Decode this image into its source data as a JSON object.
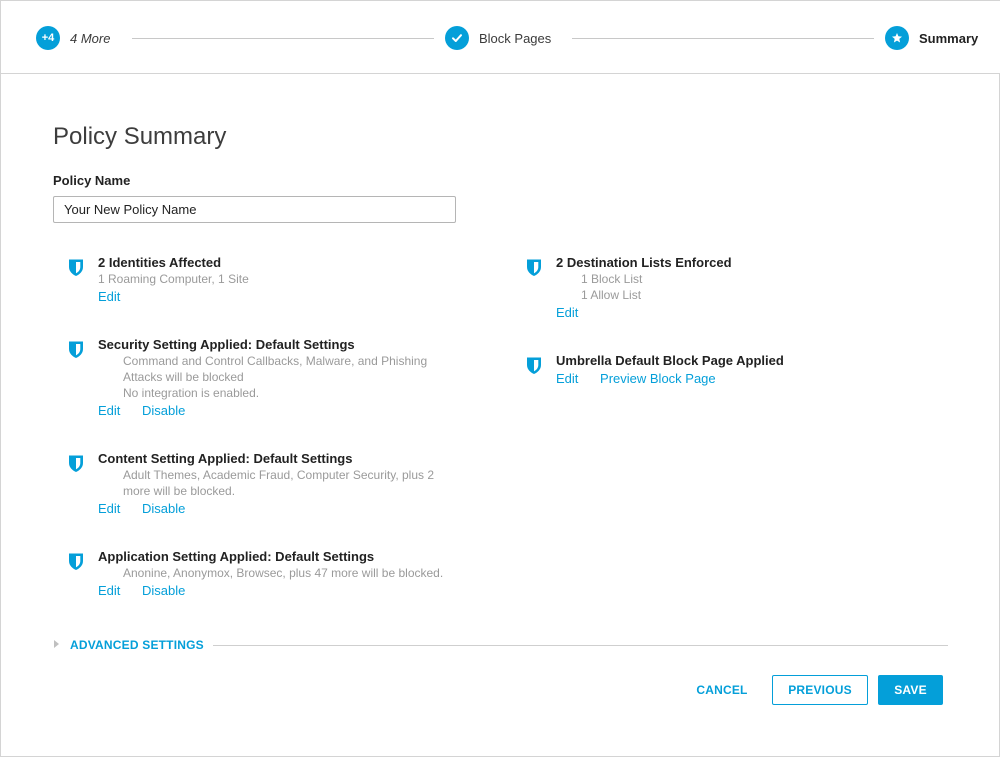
{
  "stepper": {
    "steps": [
      {
        "badge": "+4",
        "label": "4 More"
      },
      {
        "badge": "check-icon",
        "label": "Block Pages"
      },
      {
        "badge": "star-icon",
        "label": "Summary"
      }
    ]
  },
  "page": {
    "title": "Policy Summary",
    "policy_name_label": "Policy Name",
    "policy_name_value": "Your New Policy Name"
  },
  "left_items": [
    {
      "title": "2 Identities Affected",
      "desc": [
        "1 Roaming Computer, 1 Site"
      ],
      "links": [
        "Edit"
      ]
    },
    {
      "title": "Security Setting Applied: Default Settings",
      "desc": [
        "Command and Control Callbacks, Malware, and Phishing Attacks will be blocked",
        "No integration is enabled."
      ],
      "links": [
        "Edit",
        "Disable"
      ]
    },
    {
      "title": "Content Setting Applied: Default Settings",
      "desc": [
        "Adult Themes, Academic Fraud, Computer Security, plus 2 more will be blocked."
      ],
      "links": [
        "Edit",
        "Disable"
      ]
    },
    {
      "title": "Application Setting Applied: Default Settings",
      "desc": [
        "Anonine, Anonymox, Browsec, plus 47 more will be blocked."
      ],
      "links": [
        "Edit",
        "Disable"
      ]
    }
  ],
  "right_items": [
    {
      "title": "2 Destination Lists Enforced",
      "desc": [
        "1 Block List",
        "1 Allow List"
      ],
      "links": [
        "Edit"
      ]
    },
    {
      "title": "Umbrella Default Block Page Applied",
      "links": [
        "Edit",
        "Preview Block Page"
      ]
    }
  ],
  "advanced": {
    "label": "ADVANCED SETTINGS"
  },
  "footer": {
    "cancel_label": "CANCEL",
    "previous_label": "PREVIOUS",
    "save_label": "SAVE"
  },
  "colors": {
    "accent": "#049fd9",
    "muted_text": "#9a9a9a"
  }
}
